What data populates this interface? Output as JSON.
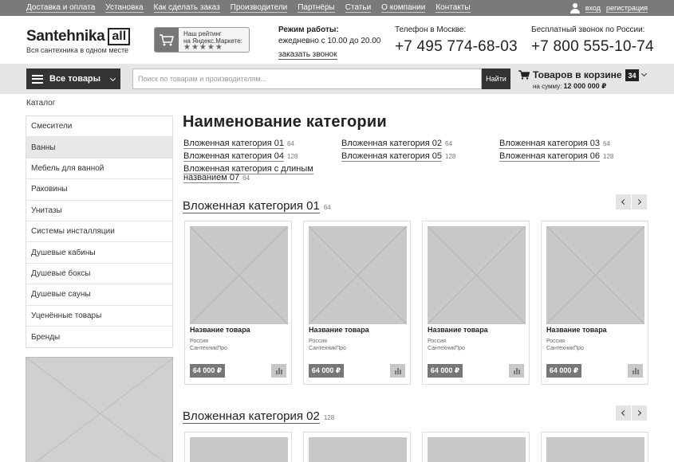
{
  "topnav": [
    "Доставка и оплата",
    "Установка",
    "Как сделать заказ",
    "Производители",
    "Партнёры",
    "Статьи",
    "О компании",
    "Контакты"
  ],
  "auth": {
    "login": "вход",
    "register": "регистрация"
  },
  "logo": {
    "name": "Santehnika",
    "box": "all",
    "tagline": "Вся сантехника в одном месте"
  },
  "ymarket": {
    "line1": "Наш рейтинг",
    "line2": "на Яндекс.Маркете:",
    "stars": "★★★★★"
  },
  "work": {
    "title": "Режим работы:",
    "hours": "ежедневно с 10.00 до 20.00",
    "call": "заказать звонок"
  },
  "phone_moscow": {
    "label": "Телефон в Москве:",
    "number": "+7 495 774-68-03"
  },
  "phone_russia": {
    "label": "Бесплатный звонок по России:",
    "number": "+7 800 555-10-74"
  },
  "searchbar": {
    "catalog_label": "Все товары",
    "placeholder": "Поиск по товарам и производителям...",
    "search_button": "Найти"
  },
  "cart": {
    "title": "Товаров в корзине",
    "sum_label": "на сумму:",
    "sum_value": "12 000 000 ₽",
    "count": "34"
  },
  "breadcrumb": "Каталог",
  "sidebar": [
    "Смесители",
    "Ванны",
    "Мебель для ванной",
    "Раковины",
    "Унитазы",
    "Системы инсталляции",
    "Душевые кабины",
    "Душевые боксы",
    "Душевые сауны",
    "Уценённые товары",
    "Бренды"
  ],
  "page_title": "Наименование категории",
  "subcategories": [
    {
      "name": "Вложенная категория 01",
      "count": "64"
    },
    {
      "name": "Вложенная категория 02",
      "count": "64"
    },
    {
      "name": "Вложенная категория 03",
      "count": "64"
    },
    {
      "name": "Вложенная категория 04",
      "count": "128"
    },
    {
      "name": "Вложенная категория 05",
      "count": "128"
    },
    {
      "name": "Вложенная категория 06",
      "count": "128"
    },
    {
      "name": "Вложенная категория с длиным названием 07",
      "count": "64"
    }
  ],
  "sections": [
    {
      "title": "Вложенная категория 01",
      "count": "64"
    },
    {
      "title": "Вложенная категория 02",
      "count": "128"
    }
  ],
  "products": [
    {
      "name": "Название товара",
      "country": "Россия",
      "brand": "СантехникПро",
      "price": "64 000 ₽"
    },
    {
      "name": "Название товара",
      "country": "Россия",
      "brand": "СантехникПро",
      "price": "64 000 ₽"
    },
    {
      "name": "Название товара",
      "country": "Россия",
      "brand": "СантехникПро",
      "price": "64 000 ₽"
    },
    {
      "name": "Название товара",
      "country": "Россия",
      "brand": "СантехникПро",
      "price": "64 000 ₽"
    }
  ],
  "colors": {
    "topbar": "#7a7a7a",
    "dark": "#333333",
    "searchbar_bg": "#e6e6e6",
    "price_bg": "#777777",
    "placeholder_img": "#c8c8c8"
  }
}
